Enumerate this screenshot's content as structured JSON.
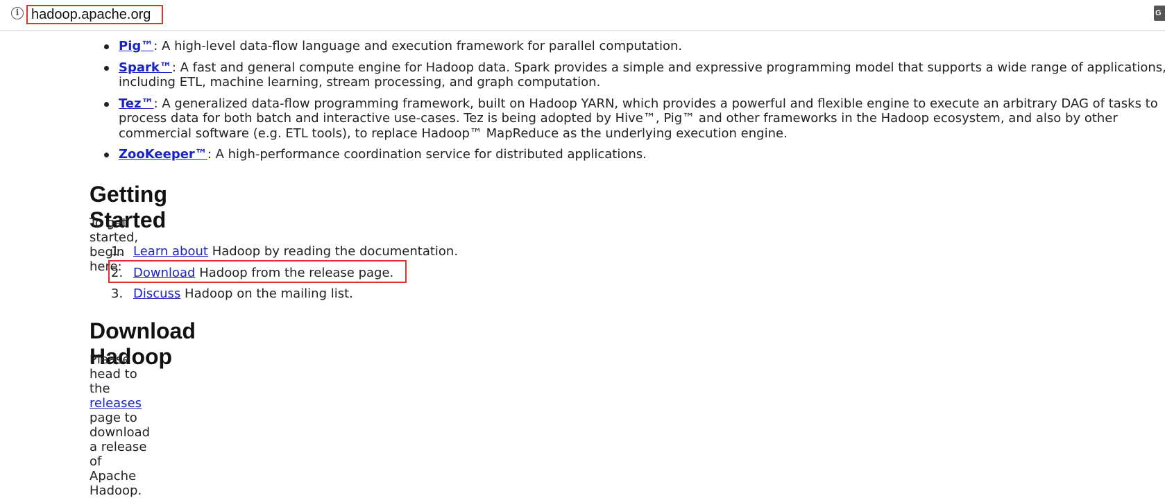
{
  "browser": {
    "url": "hadoop.apache.org",
    "info_icon": "info-icon",
    "translate_icon": "translate-icon",
    "translate_glyph": "G"
  },
  "projects": [
    {
      "name": "Pig™",
      "desc": ": A high-level data-flow language and execution framework for parallel computation."
    },
    {
      "name": "Spark™",
      "desc": ": A fast and general compute engine for Hadoop data. Spark provides a simple and expressive programming model that supports a wide range of applications, including ETL, machine learning, stream processing, and graph computation."
    },
    {
      "name": "Tez™",
      "desc": ": A generalized data-flow programming framework, built on Hadoop YARN, which provides a powerful and flexible engine to execute an arbitrary DAG of tasks to process data for both batch and interactive use-cases. Tez is being adopted by Hive™, Pig™ and other frameworks in the Hadoop ecosystem, and also by other commercial software (e.g. ETL tools), to replace Hadoop™ MapReduce as the underlying execution engine."
    },
    {
      "name": "ZooKeeper™",
      "desc": ": A high-performance coordination service for distributed applications."
    }
  ],
  "getting_started": {
    "heading": "Getting Started",
    "intro": "To get started, begin here:",
    "steps": [
      {
        "num": "1.",
        "link": "Learn about",
        "rest": " Hadoop by reading the documentation."
      },
      {
        "num": "2.",
        "link": "Download",
        "rest": " Hadoop from the release page."
      },
      {
        "num": "3.",
        "link": "Discuss",
        "rest": " Hadoop on the mailing list."
      }
    ]
  },
  "download": {
    "heading": "Download Hadoop",
    "text_before": "Please head to the ",
    "link": "releases",
    "text_after": " page to download a release of Apache Hadoop."
  },
  "colors": {
    "link": "#1a23c4",
    "highlight": "#e0302a"
  }
}
